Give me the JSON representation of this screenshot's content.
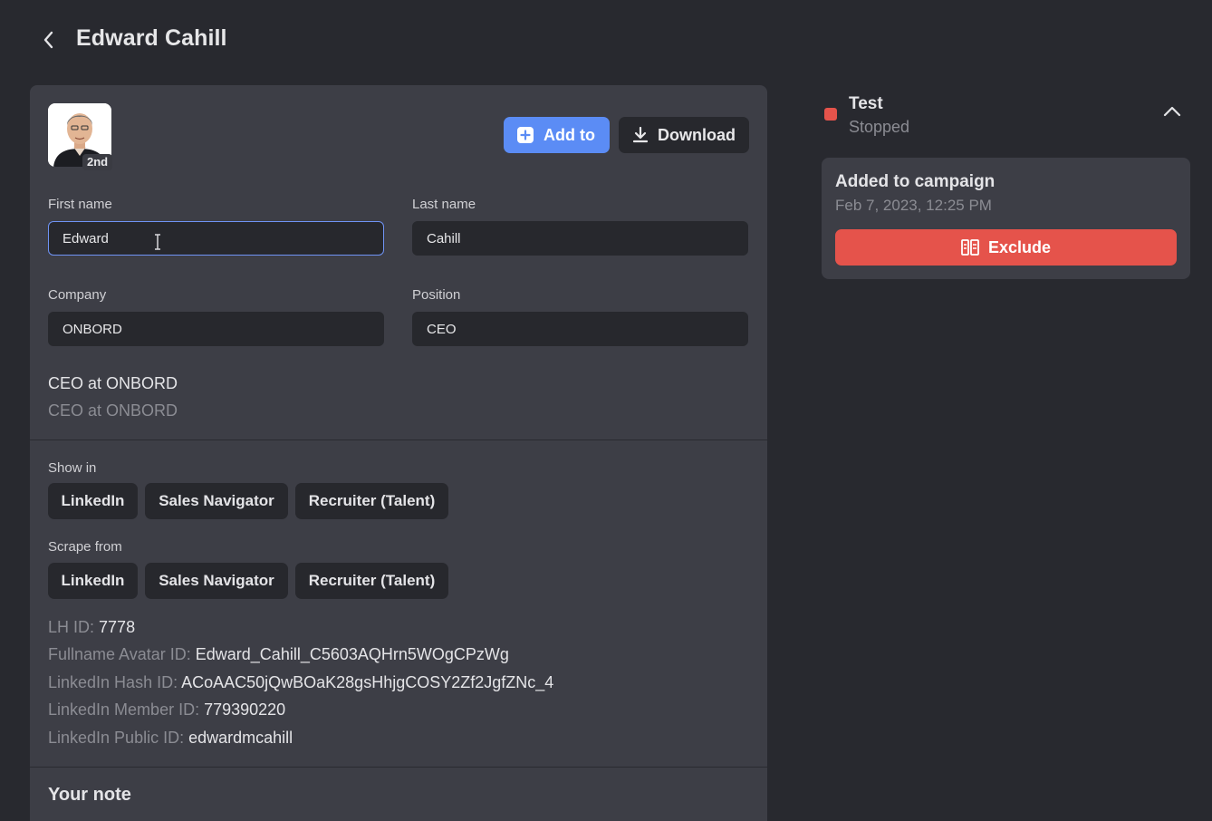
{
  "header": {
    "title": "Edward Cahill",
    "back_icon": "chevron-left-icon"
  },
  "profile": {
    "degree": "2nd",
    "buttons": {
      "add_to": "Add to",
      "download": "Download"
    },
    "fields": {
      "first_name": {
        "label": "First name",
        "value": "Edward"
      },
      "last_name": {
        "label": "Last name",
        "value": "Cahill"
      },
      "company": {
        "label": "Company",
        "value": "ONBORD"
      },
      "position": {
        "label": "Position",
        "value": "CEO"
      }
    },
    "headline": "CEO at ONBORD",
    "headline_secondary": "CEO at ONBORD",
    "show_in": {
      "label": "Show in",
      "options": [
        "LinkedIn",
        "Sales Navigator",
        "Recruiter (Talent)"
      ]
    },
    "scrape_from": {
      "label": "Scrape from",
      "options": [
        "LinkedIn",
        "Sales Navigator",
        "Recruiter (Talent)"
      ]
    },
    "ids": [
      {
        "key": "LH ID:",
        "value": "7778"
      },
      {
        "key": "Fullname Avatar ID:",
        "value": "Edward_Cahill_C5603AQHrn5WOgCPzWg"
      },
      {
        "key": "LinkedIn Hash ID:",
        "value": "ACoAAC50jQwBOaK28gsHhjgCOSY2Zf2JgfZNc_4"
      },
      {
        "key": "LinkedIn Member ID:",
        "value": "779390220"
      },
      {
        "key": "LinkedIn Public ID:",
        "value": "edwardmcahill"
      }
    ],
    "note_title": "Your note"
  },
  "campaign": {
    "name": "Test",
    "status": "Stopped",
    "status_color": "#e5534b",
    "event_title": "Added to campaign",
    "event_date": "Feb 7, 2023, 12:25 PM",
    "exclude_label": "Exclude"
  },
  "colors": {
    "background": "#28292f",
    "card": "#3d3e46",
    "accent": "#5b8cf5",
    "danger": "#e5534b"
  }
}
